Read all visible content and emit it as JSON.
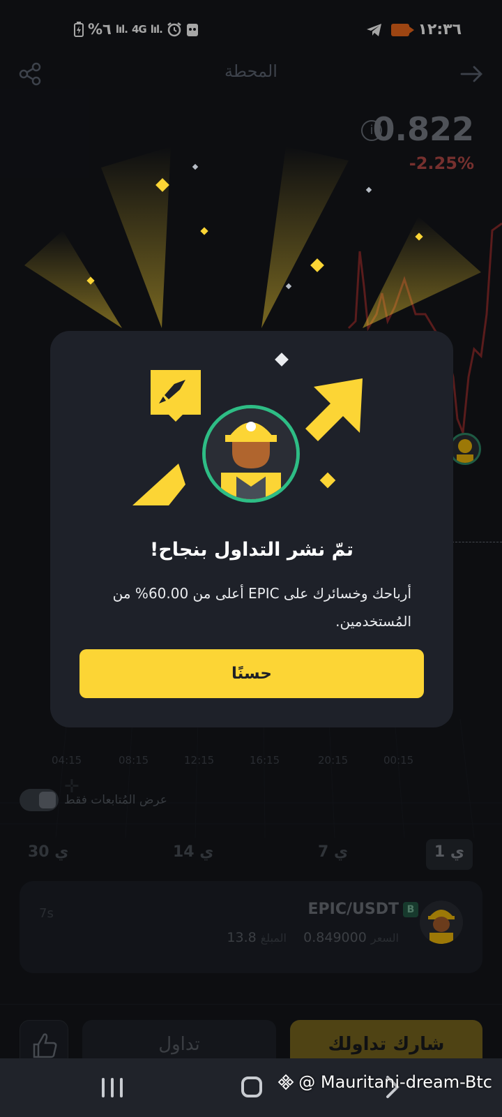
{
  "status_bar": {
    "time": "١٢:٣٦",
    "battery": "%٦",
    "network": "4G"
  },
  "header": {
    "title": "المحطة"
  },
  "background": {
    "price": "0.822",
    "change": "-2.25%",
    "time_ticks": [
      "00:15",
      "20:15",
      "16:15",
      "12:15",
      "08:15",
      "04:15"
    ],
    "follow_only_label": "عرض المُتابعات فقط",
    "periods": [
      {
        "label": "1 ي",
        "active": true
      },
      {
        "label": "7 ي",
        "active": false
      },
      {
        "label": "14 ي",
        "active": false
      },
      {
        "label": "30 ي",
        "active": false
      }
    ],
    "trade_card": {
      "pair": "EPIC/USDT",
      "badge": "B",
      "price_label": "السعر",
      "price": "0.849000",
      "amount_label": "المبلغ",
      "amount": "13.8",
      "age": "7s"
    },
    "trade_button": "تداول",
    "share_trade_button": "شارك تداولك"
  },
  "modal": {
    "title": "تمّ نشر التداول بنجاح!",
    "text": "أرباحك وخسائرك على EPIC أعلى من 60.00% من المُستخدمين.",
    "ok_button": "حسنًا"
  },
  "watermark": "@ Mauritani-dream-Btc",
  "colors": {
    "accent": "#fcd535",
    "negative": "#f6465d",
    "positive": "#2ebd85",
    "modal_bg": "#1e2129"
  }
}
